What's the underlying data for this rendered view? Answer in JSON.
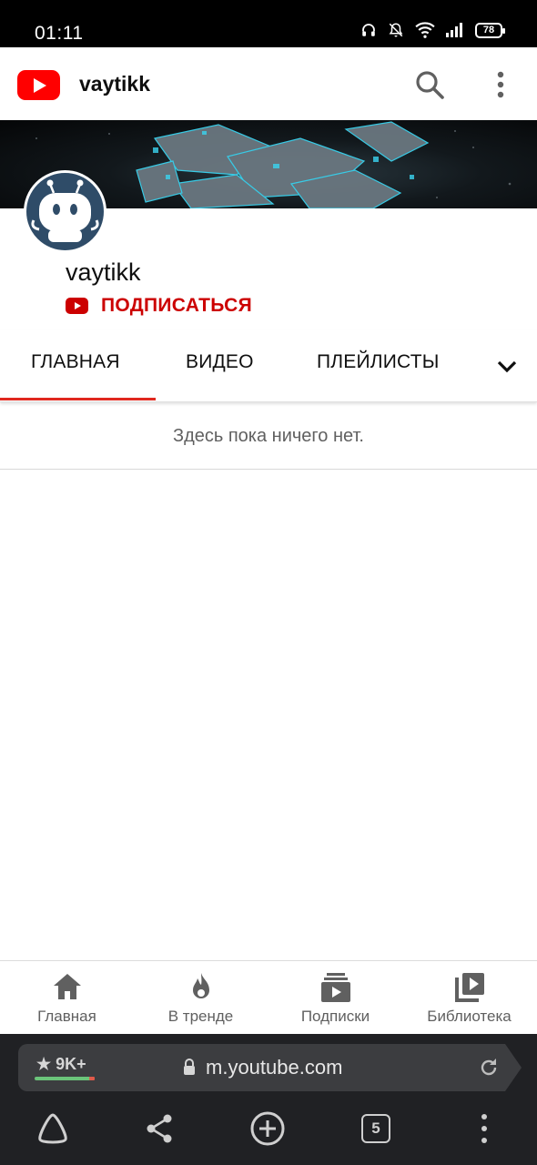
{
  "status_bar": {
    "time": "01:11",
    "battery": "78"
  },
  "header": {
    "channel_title": "vaytikk",
    "search_icon": "search-icon",
    "more_icon": "more-vert-icon"
  },
  "channel": {
    "name": "vaytikk",
    "subscribe_label": "ПОДПИСАТЬСЯ"
  },
  "tabs": [
    {
      "label": "ГЛАВНАЯ",
      "active": true
    },
    {
      "label": "ВИДЕО",
      "active": false
    },
    {
      "label": "ПЛЕЙЛИСТЫ",
      "active": false
    }
  ],
  "empty_message": "Здесь пока ничего нет.",
  "bottom_nav": [
    {
      "label": "Главная",
      "icon": "home-icon"
    },
    {
      "label": "В тренде",
      "icon": "flame-icon"
    },
    {
      "label": "Подписки",
      "icon": "subscriptions-icon"
    },
    {
      "label": "Библиотека",
      "icon": "library-icon"
    }
  ],
  "browser": {
    "rating": "★ 9K+",
    "url": "m.youtube.com",
    "tabs_count": "5"
  },
  "colors": {
    "brand_red": "#ff0000",
    "subscribe_red": "#cc0000",
    "tab_indicator": "#e0281f",
    "avatar_bg": "#2f4c68"
  }
}
